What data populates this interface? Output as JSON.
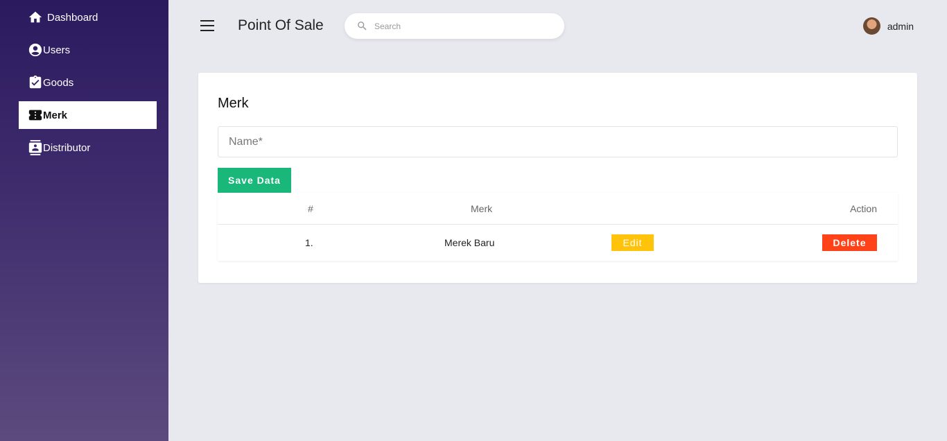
{
  "sidebar": {
    "items": [
      {
        "label": "Dashboard",
        "icon": "home-icon",
        "active": false
      },
      {
        "label": "Users",
        "icon": "user-circle-icon",
        "active": false
      },
      {
        "label": "Goods",
        "icon": "clipboard-check-icon",
        "active": false
      },
      {
        "label": "Merk",
        "icon": "ticket-icon",
        "active": true
      },
      {
        "label": "Distributor",
        "icon": "contact-card-icon",
        "active": false
      }
    ]
  },
  "header": {
    "menu_icon": "hamburger-menu-icon",
    "title": "Point Of Sale",
    "search": {
      "placeholder": "Search",
      "value": ""
    },
    "user": {
      "name": "admin",
      "avatar": "avatar"
    }
  },
  "main": {
    "card_title": "Merk",
    "name_field": {
      "placeholder": "Name*",
      "value": ""
    },
    "save_label": "Save Data",
    "table": {
      "columns": [
        "#",
        "Merk",
        "Action"
      ],
      "rows": [
        {
          "no": "1.",
          "merk": "Merek Baru",
          "edit_label": "Edit",
          "delete_label": "Delete"
        }
      ]
    }
  },
  "colors": {
    "sidebar_top": "#2b1a5e",
    "sidebar_bottom": "#5c4a7e",
    "save": "#19b87a",
    "edit": "#ffc30b",
    "delete": "#ff4218"
  }
}
